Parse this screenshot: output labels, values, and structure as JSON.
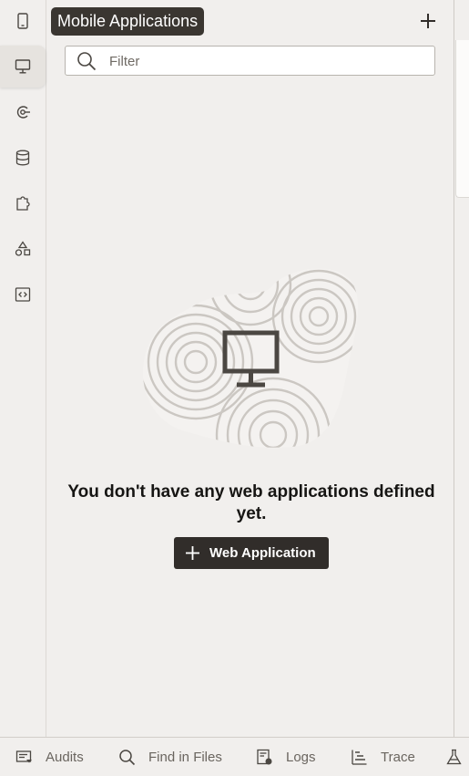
{
  "tooltip": {
    "text": "Mobile Applications"
  },
  "filter": {
    "placeholder": "Filter",
    "value": ""
  },
  "empty_state": {
    "message": "You don't have any web applications defined yet.",
    "button_label": "Web Application"
  },
  "sidebar": {
    "items": [
      {
        "name": "mobile-applications",
        "icon": "mobile-icon"
      },
      {
        "name": "web-applications",
        "icon": "desktop-icon",
        "active": true
      },
      {
        "name": "processes",
        "icon": "process-icon"
      },
      {
        "name": "business-objects",
        "icon": "database-icon"
      },
      {
        "name": "components",
        "icon": "puzzle-icon"
      },
      {
        "name": "custom",
        "icon": "shapes-icon"
      },
      {
        "name": "source",
        "icon": "code-icon"
      }
    ]
  },
  "bottom_bar": {
    "items": [
      {
        "label": "Audits",
        "icon": "audits-icon"
      },
      {
        "label": "Find in Files",
        "icon": "search-icon"
      },
      {
        "label": "Logs",
        "icon": "logs-icon"
      },
      {
        "label": "Trace",
        "icon": "trace-icon"
      },
      {
        "label": "",
        "icon": "flask-icon"
      }
    ]
  },
  "colors": {
    "primary_dark": "#312d2a",
    "background": "#f1efed",
    "icon": "#4b4742"
  }
}
